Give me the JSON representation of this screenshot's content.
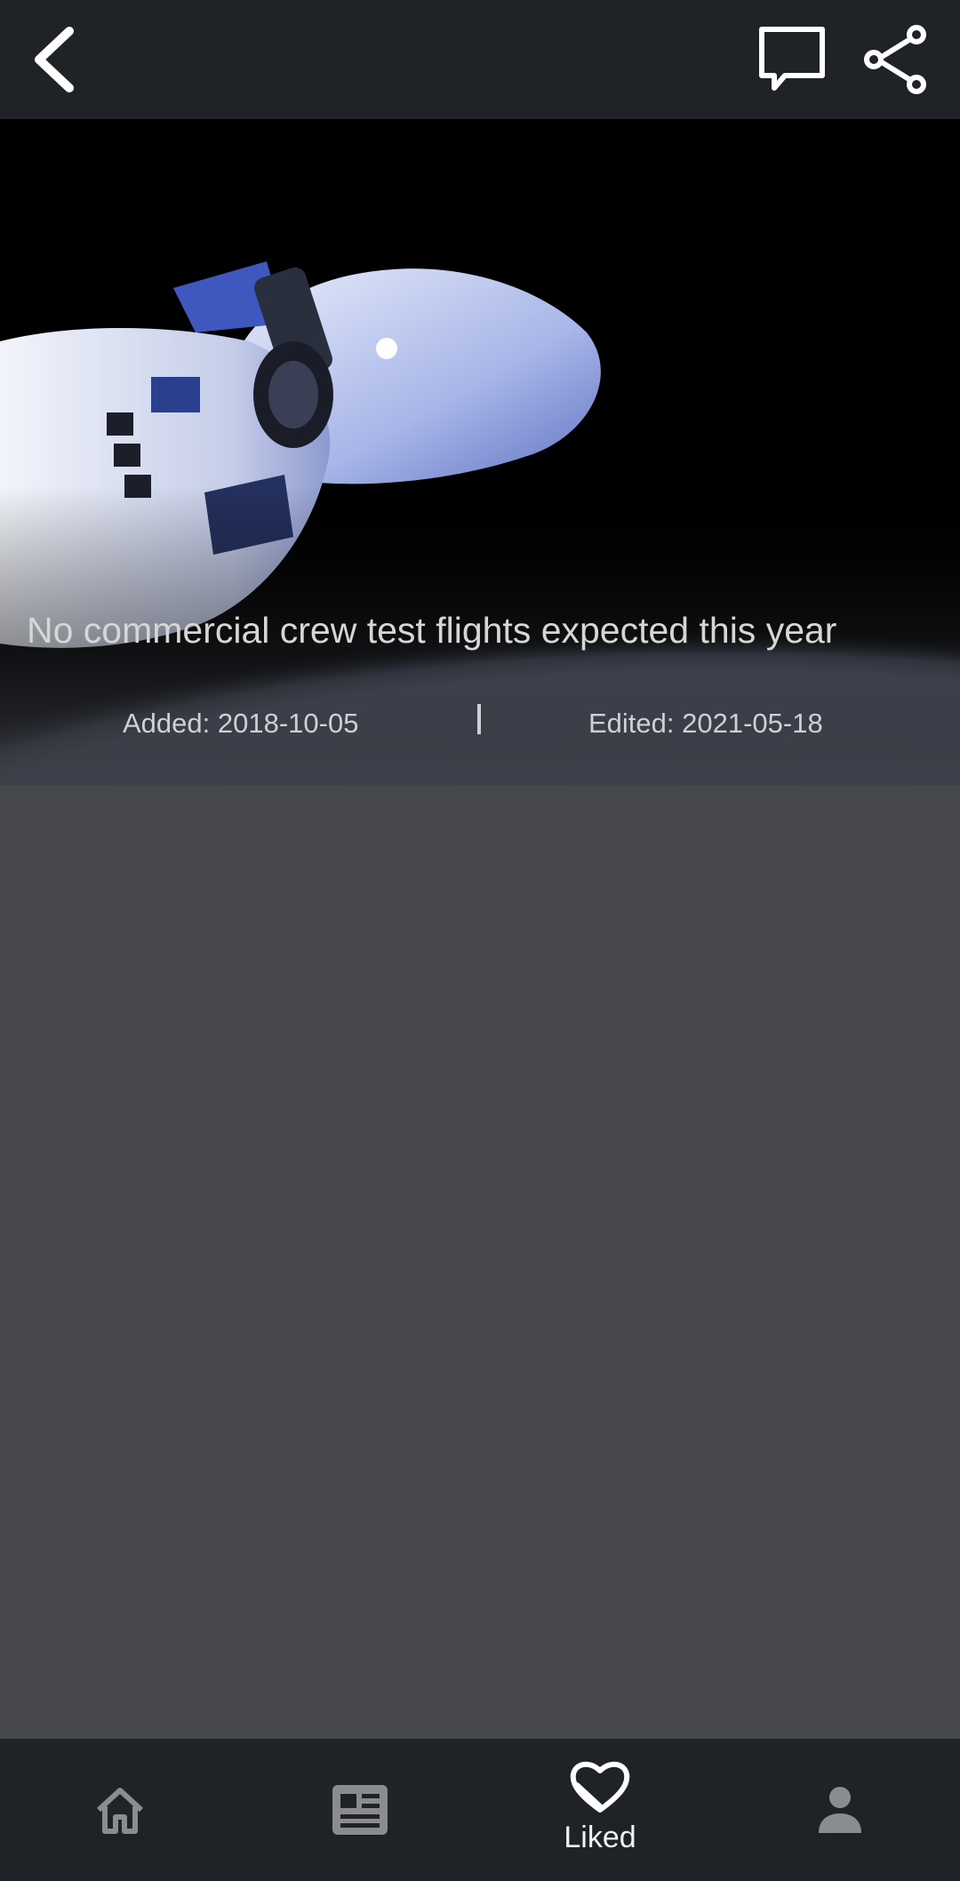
{
  "topbar": {
    "back_icon": "chevron-left-icon",
    "comment_icon": "comment-icon",
    "share_icon": "share-icon"
  },
  "article": {
    "title": "No commercial crew test flights expected this year",
    "added": "Added: 2018-10-05",
    "edited": "Edited: 2021-05-18",
    "image": "spacecraft-image"
  },
  "bottom_nav": {
    "items": [
      {
        "icon": "home-icon",
        "label": ""
      },
      {
        "icon": "news-icon",
        "label": ""
      },
      {
        "icon": "heart-icon",
        "label": "Liked"
      },
      {
        "icon": "person-icon",
        "label": ""
      }
    ],
    "active": "Liked"
  },
  "colors": {
    "bar": "#1f2226",
    "background": "#47484b",
    "text": "#d6d6d6"
  }
}
